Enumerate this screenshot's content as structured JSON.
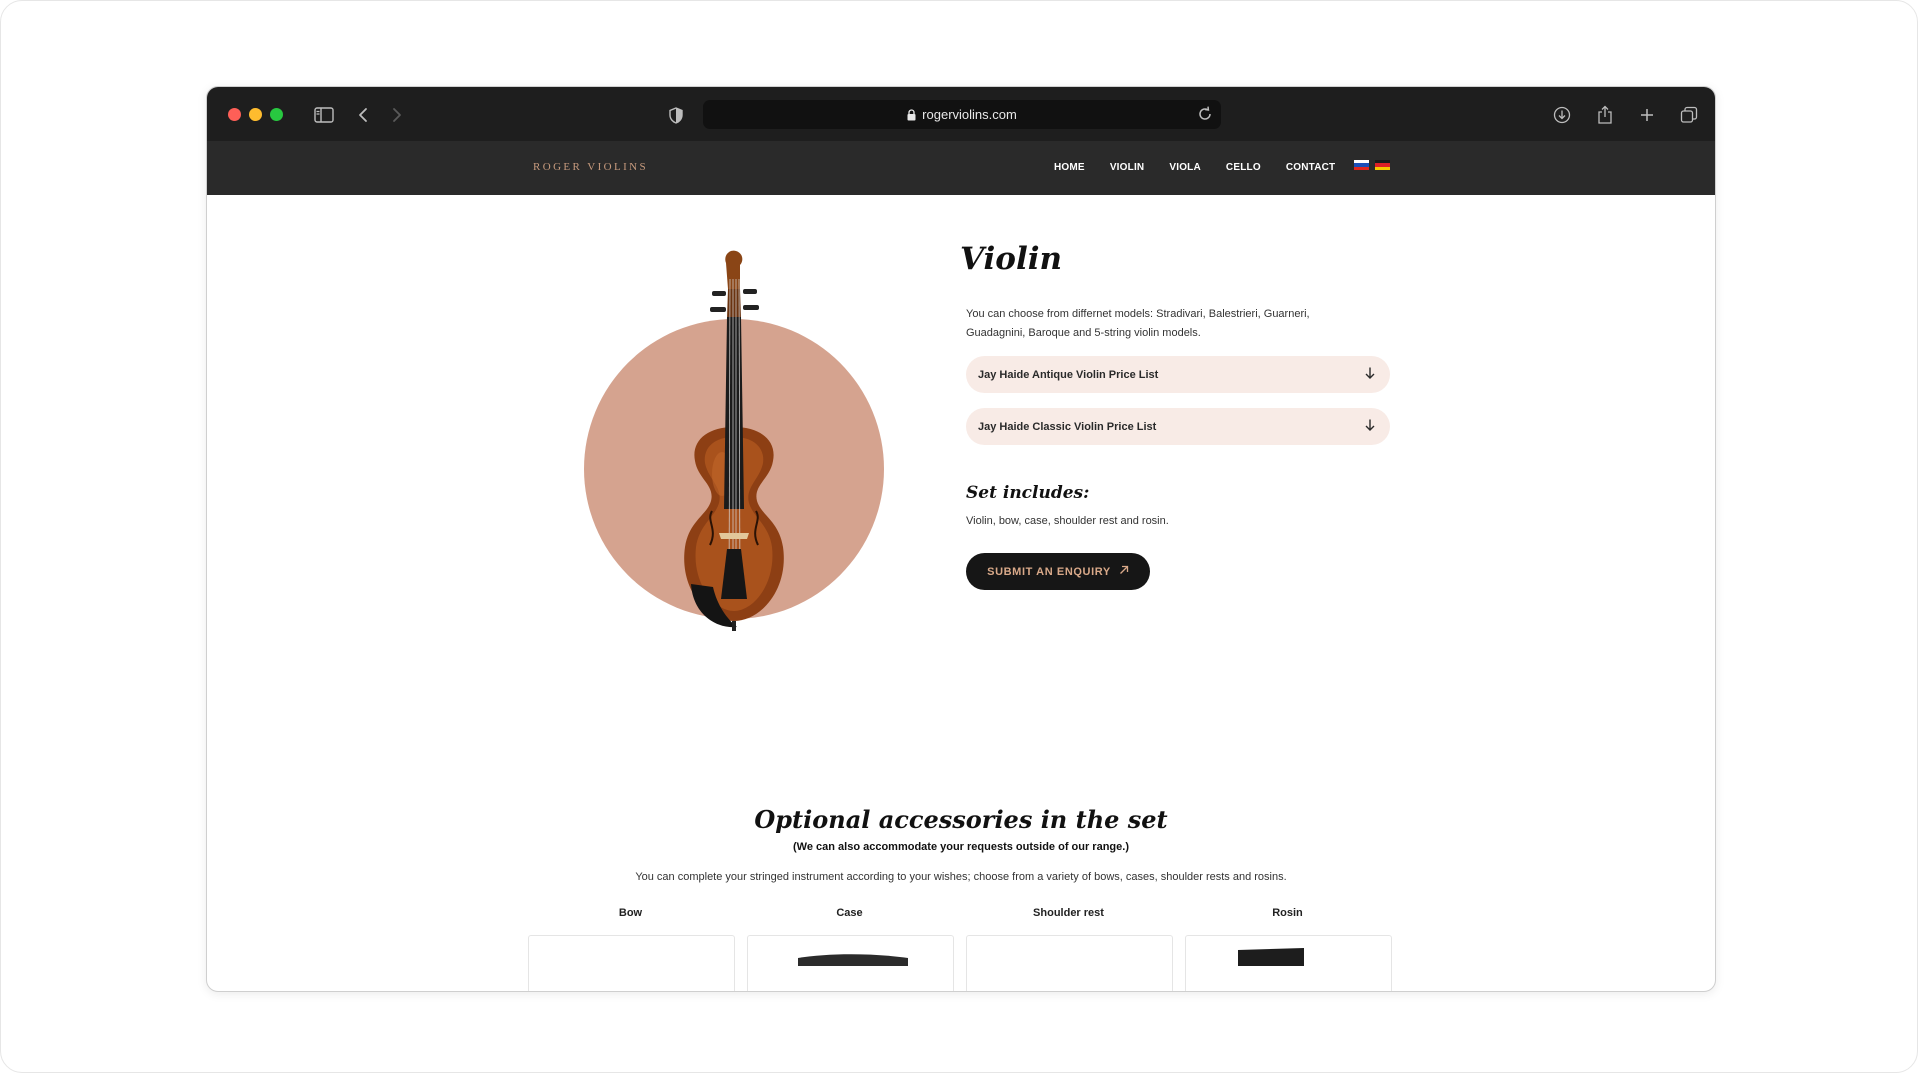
{
  "browser": {
    "url": "rogerviolins.com"
  },
  "site": {
    "logo": "ROGER VIOLINS",
    "nav": [
      "HOME",
      "VIOLIN",
      "VIOLA",
      "CELLO",
      "CONTACT"
    ]
  },
  "main": {
    "title": "Violin",
    "intro": "You can choose from differnet models: Stradivari, Balestrieri, Guarneri, Guadagnini, Baroque and 5-string violin models.",
    "price_lists": [
      "Jay Haide Antique Violin Price List",
      "Jay Haide Classic Violin Price List"
    ],
    "set_title": "Set includes:",
    "set_text": "Violin, bow, case, shoulder rest and rosin.",
    "cta": "SUBMIT AN ENQUIRY"
  },
  "accessories": {
    "title": "Optional accessories in the set",
    "note": "(We can also accommodate your requests outside of our range.)",
    "description": "You can complete your stringed instrument according to your wishes; choose from a variety of bows, cases, shoulder rests and rosins.",
    "items": [
      "Bow",
      "Case",
      "Shoulder rest",
      "Rosin"
    ]
  },
  "colors": {
    "accent": "#d5a38f",
    "accordion_bg": "#f8ebe6",
    "nav_bg": "#2a2a2a",
    "button_bg": "#161616"
  },
  "icons": [
    "sidebar-icon",
    "back-icon",
    "forward-icon",
    "shield-icon",
    "lock-icon",
    "reload-icon",
    "download-icon",
    "share-icon",
    "new-tab-icon",
    "tabs-icon",
    "arrow-down-icon",
    "arrow-up-right-icon"
  ]
}
